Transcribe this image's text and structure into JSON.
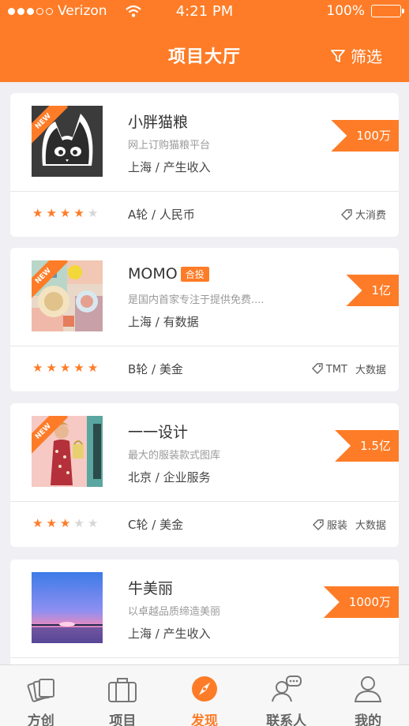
{
  "status_bar": {
    "carrier": "Verizon",
    "time": "4:21 PM",
    "battery": "100%"
  },
  "nav": {
    "title": "项目大厅",
    "filter_label": "筛选"
  },
  "projects": [
    {
      "name": "小胖猫粮",
      "badge": "",
      "desc": "网上订购猫粮平台",
      "meta": "上海 / 产生收入",
      "amount": "100万",
      "is_new": true,
      "rating": 4,
      "round": "A轮 / 人民币",
      "tags": [
        "大消费"
      ],
      "tag_with_icon": true
    },
    {
      "name": "MOMO",
      "badge": "合投",
      "desc": "是国内首家专注于提供免费....",
      "meta": "上海 / 有数据",
      "amount": "1亿",
      "is_new": true,
      "rating": 5,
      "round": "B轮 / 美金",
      "tags": [
        "TMT",
        "大数据"
      ],
      "tag_with_icon": true
    },
    {
      "name": "一一设计",
      "badge": "",
      "desc": "最大的服装款式图库",
      "meta": "北京 / 企业服务",
      "amount": "1.5亿",
      "is_new": true,
      "rating": 3,
      "round": "C轮 / 美金",
      "tags": [
        "服装",
        "大数据"
      ],
      "tag_with_icon": true
    },
    {
      "name": "牛美丽",
      "badge": "",
      "desc": "以卓越品质缔造美丽",
      "meta": "上海 / 产生收入",
      "amount": "1000万",
      "is_new": false,
      "rating": 0,
      "round": "",
      "tags": [],
      "tag_with_icon": false
    }
  ],
  "new_ribbon": "NEW",
  "tabs": [
    {
      "label": "方创",
      "icon": "cards-icon",
      "active": false
    },
    {
      "label": "项目",
      "icon": "briefcase-icon",
      "active": false
    },
    {
      "label": "发现",
      "icon": "compass-icon",
      "active": true
    },
    {
      "label": "联系人",
      "icon": "chat-contacts-icon",
      "active": false
    },
    {
      "label": "我的",
      "icon": "user-icon",
      "active": false
    }
  ],
  "colors": {
    "accent": "#fe7c27",
    "background": "#efeff4"
  }
}
